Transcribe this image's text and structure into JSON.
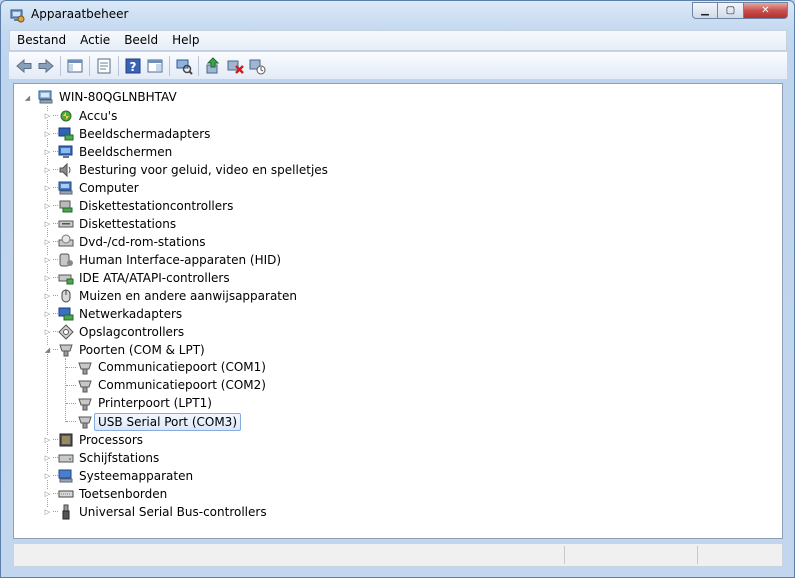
{
  "window": {
    "title": "Apparaatbeheer"
  },
  "menu": [
    "Bestand",
    "Actie",
    "Beeld",
    "Help"
  ],
  "toolbar": {
    "buttons": [
      "back-icon",
      "forward-icon",
      "show-hide-console-tree-icon",
      "properties-icon",
      "help-icon",
      "view-icon",
      "scan-hardware-icon",
      "update-driver-icon",
      "uninstall-icon",
      "disable-icon"
    ]
  },
  "tree": {
    "root": "WIN-80QGLNBHTAV",
    "items": [
      {
        "label": "Accu's",
        "icon": "battery-icon"
      },
      {
        "label": "Beeldschermadapters",
        "icon": "display-adapter-icon"
      },
      {
        "label": "Beeldschermen",
        "icon": "monitor-icon"
      },
      {
        "label": "Besturing voor geluid, video en spelletjes",
        "icon": "speaker-icon"
      },
      {
        "label": "Computer",
        "icon": "computer-icon"
      },
      {
        "label": "Diskettestationcontrollers",
        "icon": "floppy-controller-icon"
      },
      {
        "label": "Diskettestations",
        "icon": "floppy-drive-icon"
      },
      {
        "label": "Dvd-/cd-rom-stations",
        "icon": "dvd-drive-icon"
      },
      {
        "label": "Human Interface-apparaten (HID)",
        "icon": "hid-icon"
      },
      {
        "label": "IDE ATA/ATAPI-controllers",
        "icon": "ide-controller-icon"
      },
      {
        "label": "Muizen en andere aanwijsapparaten",
        "icon": "mouse-icon"
      },
      {
        "label": "Netwerkadapters",
        "icon": "network-adapter-icon"
      },
      {
        "label": "Opslagcontrollers",
        "icon": "storage-controller-icon"
      },
      {
        "label": "Poorten (COM & LPT)",
        "icon": "port-icon",
        "expanded": true
      },
      {
        "label": "Processors",
        "icon": "processor-icon"
      },
      {
        "label": "Schijfstations",
        "icon": "disk-drive-icon"
      },
      {
        "label": "Systeemapparaten",
        "icon": "system-device-icon"
      },
      {
        "label": "Toetsenborden",
        "icon": "keyboard-icon"
      },
      {
        "label": "Universal Serial Bus-controllers",
        "icon": "usb-icon"
      }
    ],
    "ports_children": [
      {
        "label": "Communicatiepoort (COM1)"
      },
      {
        "label": "Communicatiepoort (COM2)"
      },
      {
        "label": "Printerpoort (LPT1)"
      },
      {
        "label": "USB Serial Port (COM3)",
        "selected": true
      }
    ]
  },
  "colors": {
    "selection_border": "#84acdd",
    "window_frame": "#bfd4ed"
  }
}
